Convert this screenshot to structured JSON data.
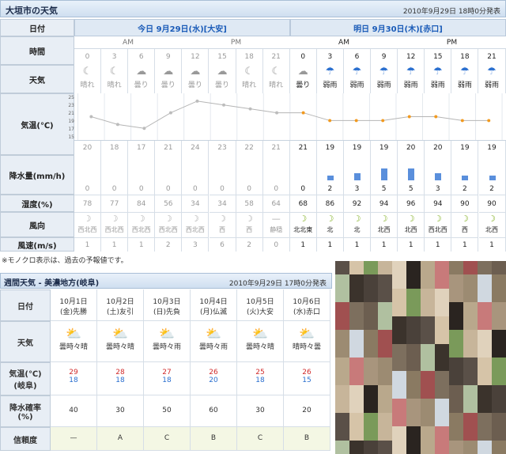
{
  "header": {
    "title": "大垣市の天気",
    "stamp": "2010年9月29日 18時0分発表"
  },
  "labels": {
    "date": "日付",
    "time": "時間",
    "weather": "天気",
    "temp": "気温(℃)",
    "rain": "降水量(mm/h)",
    "humidity": "湿度(%)",
    "wind_dir": "風向",
    "wind_speed": "風速(m/s)"
  },
  "days": [
    {
      "label": "今日  9月29日(水)[大安]"
    },
    {
      "label": "明日  9月30日(木)[赤口]"
    }
  ],
  "ampm": [
    "AM",
    "PM",
    "AM",
    "PM"
  ],
  "hours": [
    "0",
    "3",
    "6",
    "9",
    "12",
    "15",
    "18",
    "21",
    "0",
    "3",
    "6",
    "9",
    "12",
    "15",
    "18",
    "21"
  ],
  "weather": [
    "晴れ",
    "晴れ",
    "曇り",
    "曇り",
    "曇り",
    "曇り",
    "晴れ",
    "晴れ",
    "曇り",
    "弱雨",
    "弱雨",
    "弱雨",
    "弱雨",
    "弱雨",
    "弱雨",
    "弱雨"
  ],
  "temps": [
    "20",
    "18",
    "17",
    "21",
    "24",
    "23",
    "22",
    "21",
    "21",
    "19",
    "19",
    "19",
    "20",
    "20",
    "19",
    "19"
  ],
  "rain": [
    "0",
    "0",
    "0",
    "0",
    "0",
    "0",
    "0",
    "0",
    "0",
    "2",
    "3",
    "5",
    "5",
    "3",
    "2",
    "2"
  ],
  "humidity": [
    "78",
    "77",
    "84",
    "56",
    "34",
    "34",
    "58",
    "64",
    "68",
    "86",
    "92",
    "94",
    "96",
    "94",
    "90",
    "90"
  ],
  "wind_dir": [
    "西北西",
    "西北西",
    "西北西",
    "西北西",
    "西北西",
    "西",
    "西",
    "静穏",
    "北北東",
    "北",
    "北",
    "北西",
    "北西",
    "西北西",
    "西",
    "北西"
  ],
  "wind_speed": [
    "1",
    "1",
    "1",
    "2",
    "3",
    "6",
    "2",
    "0",
    "1",
    "1",
    "1",
    "1",
    "1",
    "1",
    "1",
    "1"
  ],
  "temp_axis": [
    "25",
    "23",
    "21",
    "19",
    "17",
    "15"
  ],
  "note": "※モノクロ表示は、過去の予報値です。",
  "weekly": {
    "title": "週間天気 - 美濃地方(岐阜)",
    "stamp": "2010年9月29日 17時0分発表",
    "labels": {
      "date": "日付",
      "weather": "天気",
      "temp": "気温(℃)\n(岐阜)",
      "pop": "降水確率\n(%)",
      "rel": "信頼度"
    },
    "days": [
      {
        "date": "10月1日",
        "dow": "(金)先勝",
        "weather": "曇時々晴",
        "hi": "29",
        "lo": "18",
        "pop": "40",
        "rel": "—"
      },
      {
        "date": "10月2日",
        "dow": "(土)友引",
        "weather": "曇時々晴",
        "hi": "28",
        "lo": "18",
        "pop": "30",
        "rel": "A"
      },
      {
        "date": "10月3日",
        "dow": "(日)先負",
        "weather": "曇時々雨",
        "hi": "27",
        "lo": "18",
        "pop": "50",
        "rel": "C"
      },
      {
        "date": "10月4日",
        "dow": "(月)仏滅",
        "weather": "曇時々雨",
        "hi": "26",
        "lo": "20",
        "pop": "60",
        "rel": "B"
      },
      {
        "date": "10月5日",
        "dow": "(火)大安",
        "weather": "曇時々晴",
        "hi": "25",
        "lo": "18",
        "pop": "30",
        "rel": "C"
      },
      {
        "date": "10月6日",
        "dow": "(水)赤口",
        "weather": "晴時々曇",
        "hi": "26",
        "lo": "15",
        "pop": "20",
        "rel": "B"
      }
    ]
  },
  "colors": {
    "accent": "#1a5bb8",
    "rain_bar": "#5a8fdc",
    "hot": "#d12b2b",
    "cold": "#2a6fcf"
  }
}
